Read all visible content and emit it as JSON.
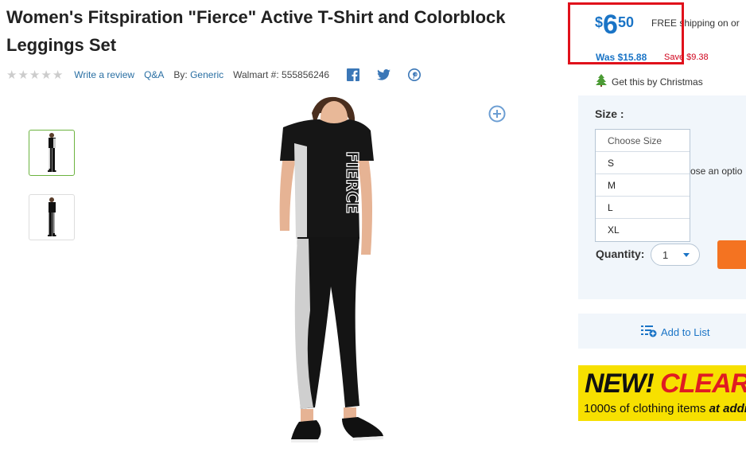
{
  "product": {
    "title": "Women's Fitspiration \"Fierce\" Active T-Shirt and Colorblock Leggings Set",
    "rating_stars": 5,
    "write_review": "Write a review",
    "qa": "Q&A",
    "by_label": "By:",
    "brand": "Generic",
    "walmart_id_label": "Walmart #:",
    "walmart_id": "555856246"
  },
  "price": {
    "currency": "$",
    "dollars": "6",
    "cents": "50",
    "shipping": "FREE shipping on or",
    "was": "Was $15.88",
    "save": "Save $9.38",
    "christmas": "Get this by Christmas"
  },
  "size": {
    "label": "Size :",
    "options": [
      "Choose Size",
      "S",
      "M",
      "L",
      "XL"
    ],
    "behind_text": "ose an optio"
  },
  "quantity": {
    "label": "Quantity:",
    "value": "1"
  },
  "add_to_list": "Add to List",
  "banner": {
    "new": "NEW!",
    "clearance": "CLEARAN",
    "line2_plain": "1000s of clothing items ",
    "line2_italic": "at additio"
  },
  "product_graphic_text": "FIERCE",
  "icons": {
    "facebook": "facebook-icon",
    "twitter": "twitter-icon",
    "pinterest": "pinterest-icon",
    "zoom": "zoom-plus-icon",
    "tree": "christmas-tree-icon",
    "list": "add-list-icon"
  },
  "colors": {
    "link": "#2a6fa3",
    "price_blue": "#1a74c6",
    "save_red": "#d0021b",
    "highlight_red": "#e0111b",
    "cart_orange": "#f47321",
    "banner_yellow": "#f7e000"
  }
}
